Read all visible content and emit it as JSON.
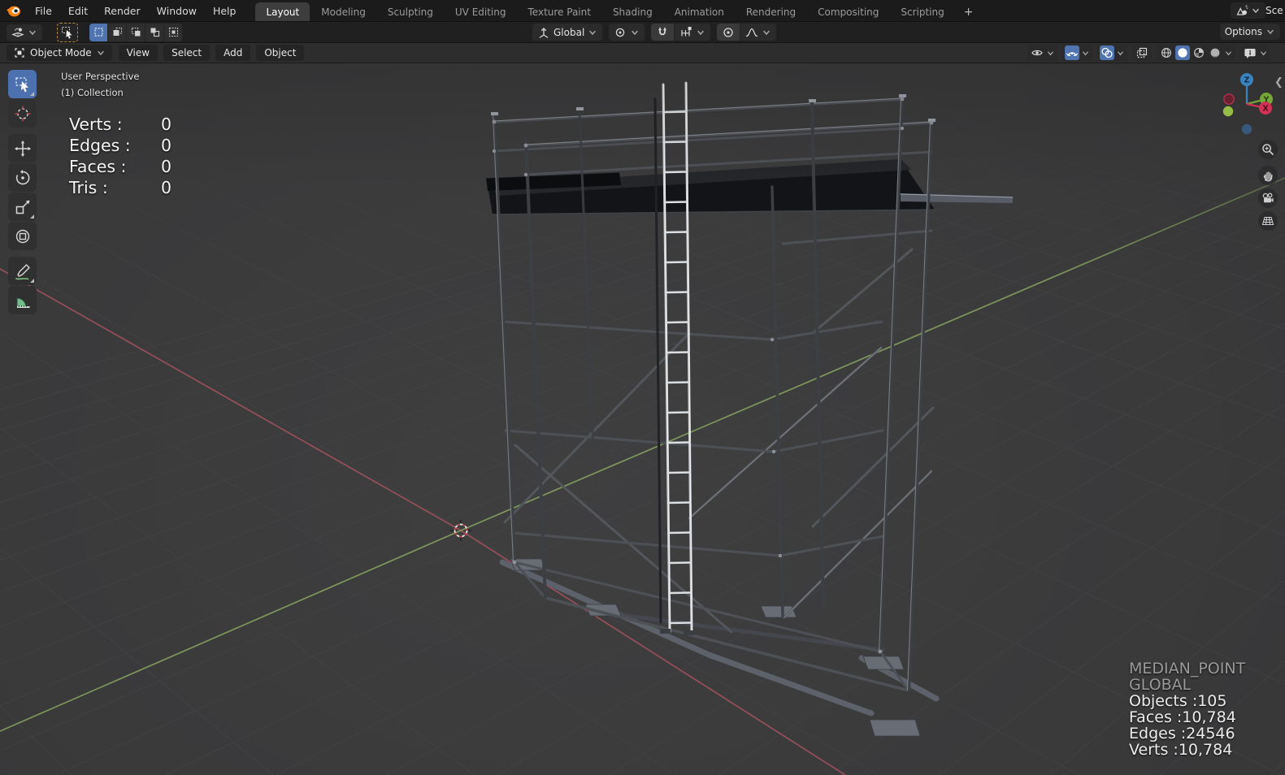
{
  "topbar": {
    "menus": [
      "File",
      "Edit",
      "Render",
      "Window",
      "Help"
    ],
    "tabs": [
      "Layout",
      "Modeling",
      "Sculpting",
      "UV Editing",
      "Texture Paint",
      "Shading",
      "Animation",
      "Rendering",
      "Compositing",
      "Scripting"
    ],
    "active_tab": "Layout",
    "new_workspace_label": "+",
    "scene_label_clipped": "Sce"
  },
  "tool_settings": {
    "orientation": "Global",
    "options_label": "Options"
  },
  "viewport_header": {
    "mode": "Object Mode",
    "menus": [
      "View",
      "Select",
      "Add",
      "Object"
    ]
  },
  "overlay": {
    "view": "User Perspective",
    "collection": "(1) Collection",
    "edit_stats": [
      {
        "label": "Verts :",
        "value": "0"
      },
      {
        "label": "Edges :",
        "value": "0"
      },
      {
        "label": "Faces :",
        "value": "0"
      },
      {
        "label": "Tris :",
        "value": "0"
      }
    ],
    "pivot": "MEDIAN_POINT",
    "orientation": "GLOBAL",
    "scene_stats": [
      "Objects :105",
      "Faces :10,784",
      "Edges :24546",
      "Verts :10,784"
    ]
  },
  "gizmo": {
    "x": "X",
    "y": "Y",
    "z": "Z"
  },
  "left_tools": [
    "select-box",
    "cursor",
    "move",
    "rotate",
    "scale",
    "transform",
    "annotate",
    "measure"
  ],
  "nav_icons": [
    "zoom",
    "pan",
    "camera-view",
    "toggle-perspective"
  ],
  "colors": {
    "accent": "#4f74b0",
    "axis_x": "#a2525e",
    "axis_y": "#8aa860",
    "gizmo_x": "#e0355a",
    "gizmo_y": "#7eb33c",
    "gizmo_z": "#3e8fd0"
  }
}
